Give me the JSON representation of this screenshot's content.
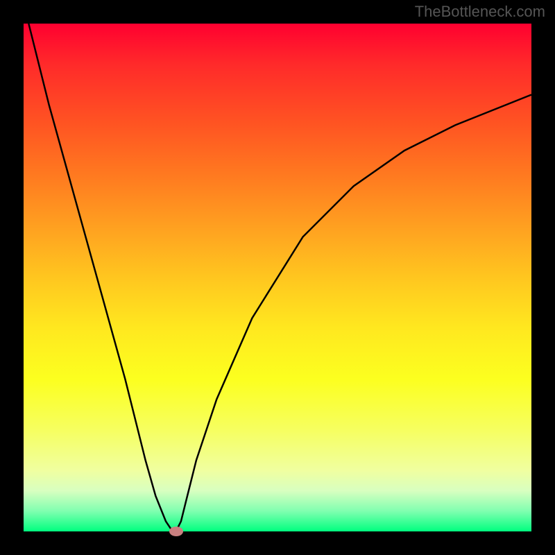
{
  "watermark": "TheBottleneck.com",
  "chart_data": {
    "type": "line",
    "title": "",
    "xlabel": "",
    "ylabel": "",
    "xlim": [
      0,
      100
    ],
    "ylim": [
      0,
      100
    ],
    "series": [
      {
        "name": "curve",
        "x": [
          1,
          5,
          10,
          15,
          20,
          24,
          26,
          28,
          29,
          30,
          31,
          32,
          34,
          38,
          45,
          55,
          65,
          75,
          85,
          95,
          100
        ],
        "y": [
          100,
          84,
          66,
          48,
          30,
          14,
          7,
          2,
          0.5,
          0,
          2,
          6,
          14,
          26,
          42,
          58,
          68,
          75,
          80,
          84,
          86
        ]
      }
    ],
    "marker": {
      "x": 30,
      "y": 0
    },
    "gradient_colors": {
      "top": "#ff0030",
      "mid": "#ffe81f",
      "bottom": "#00ff7f"
    }
  }
}
